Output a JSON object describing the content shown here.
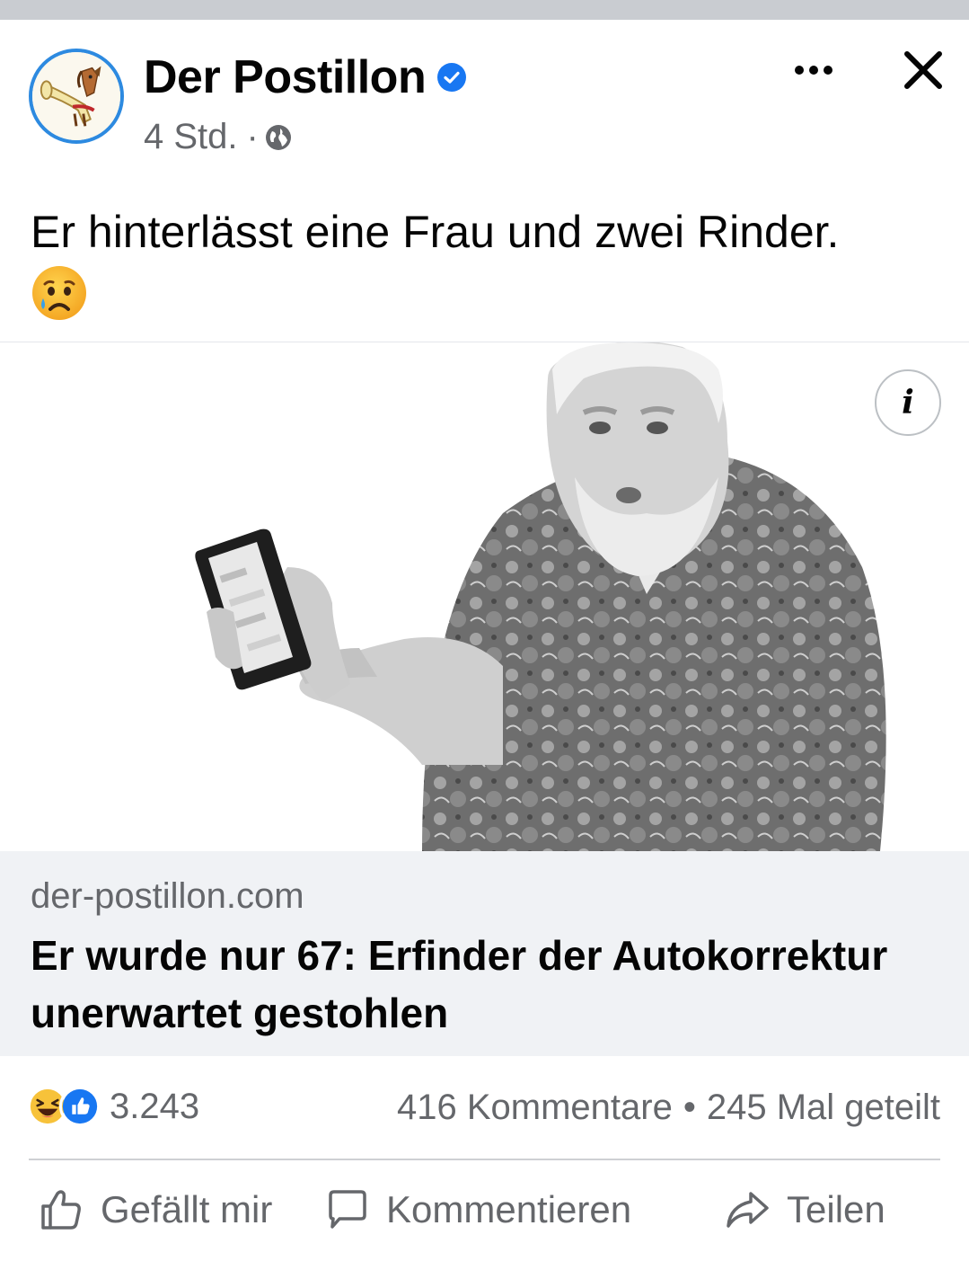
{
  "post": {
    "page_name": "Der Postillon",
    "verified": true,
    "time": "4 Std.",
    "meta_separator": "·",
    "audience_icon": "globe-icon",
    "text": "Er hinterlässt eine Frau und zwei Rinder.",
    "text_emoji": "crying-face-emoji"
  },
  "link": {
    "domain": "der-postillon.com",
    "headline": "Er wurde nur 67: Erfinder der Autokorrektur unerwartet gestohlen",
    "image": "black-and-white photo of a bearded older man in a patterned shirt pointing at a smartphone"
  },
  "stats": {
    "reaction_icons": [
      "laughing-emoji",
      "like-icon"
    ],
    "reaction_count": "3.243",
    "comments": "416 Kommentare",
    "separator": "•",
    "shares": "245 Mal geteilt"
  },
  "actions": {
    "like": "Gefällt mir",
    "comment": "Kommentieren",
    "share": "Teilen"
  },
  "colors": {
    "accent_blue": "#1877f2",
    "secondary_text": "#65676b",
    "link_bg": "#f0f2f5",
    "top_bar": "#c9ccd1"
  }
}
